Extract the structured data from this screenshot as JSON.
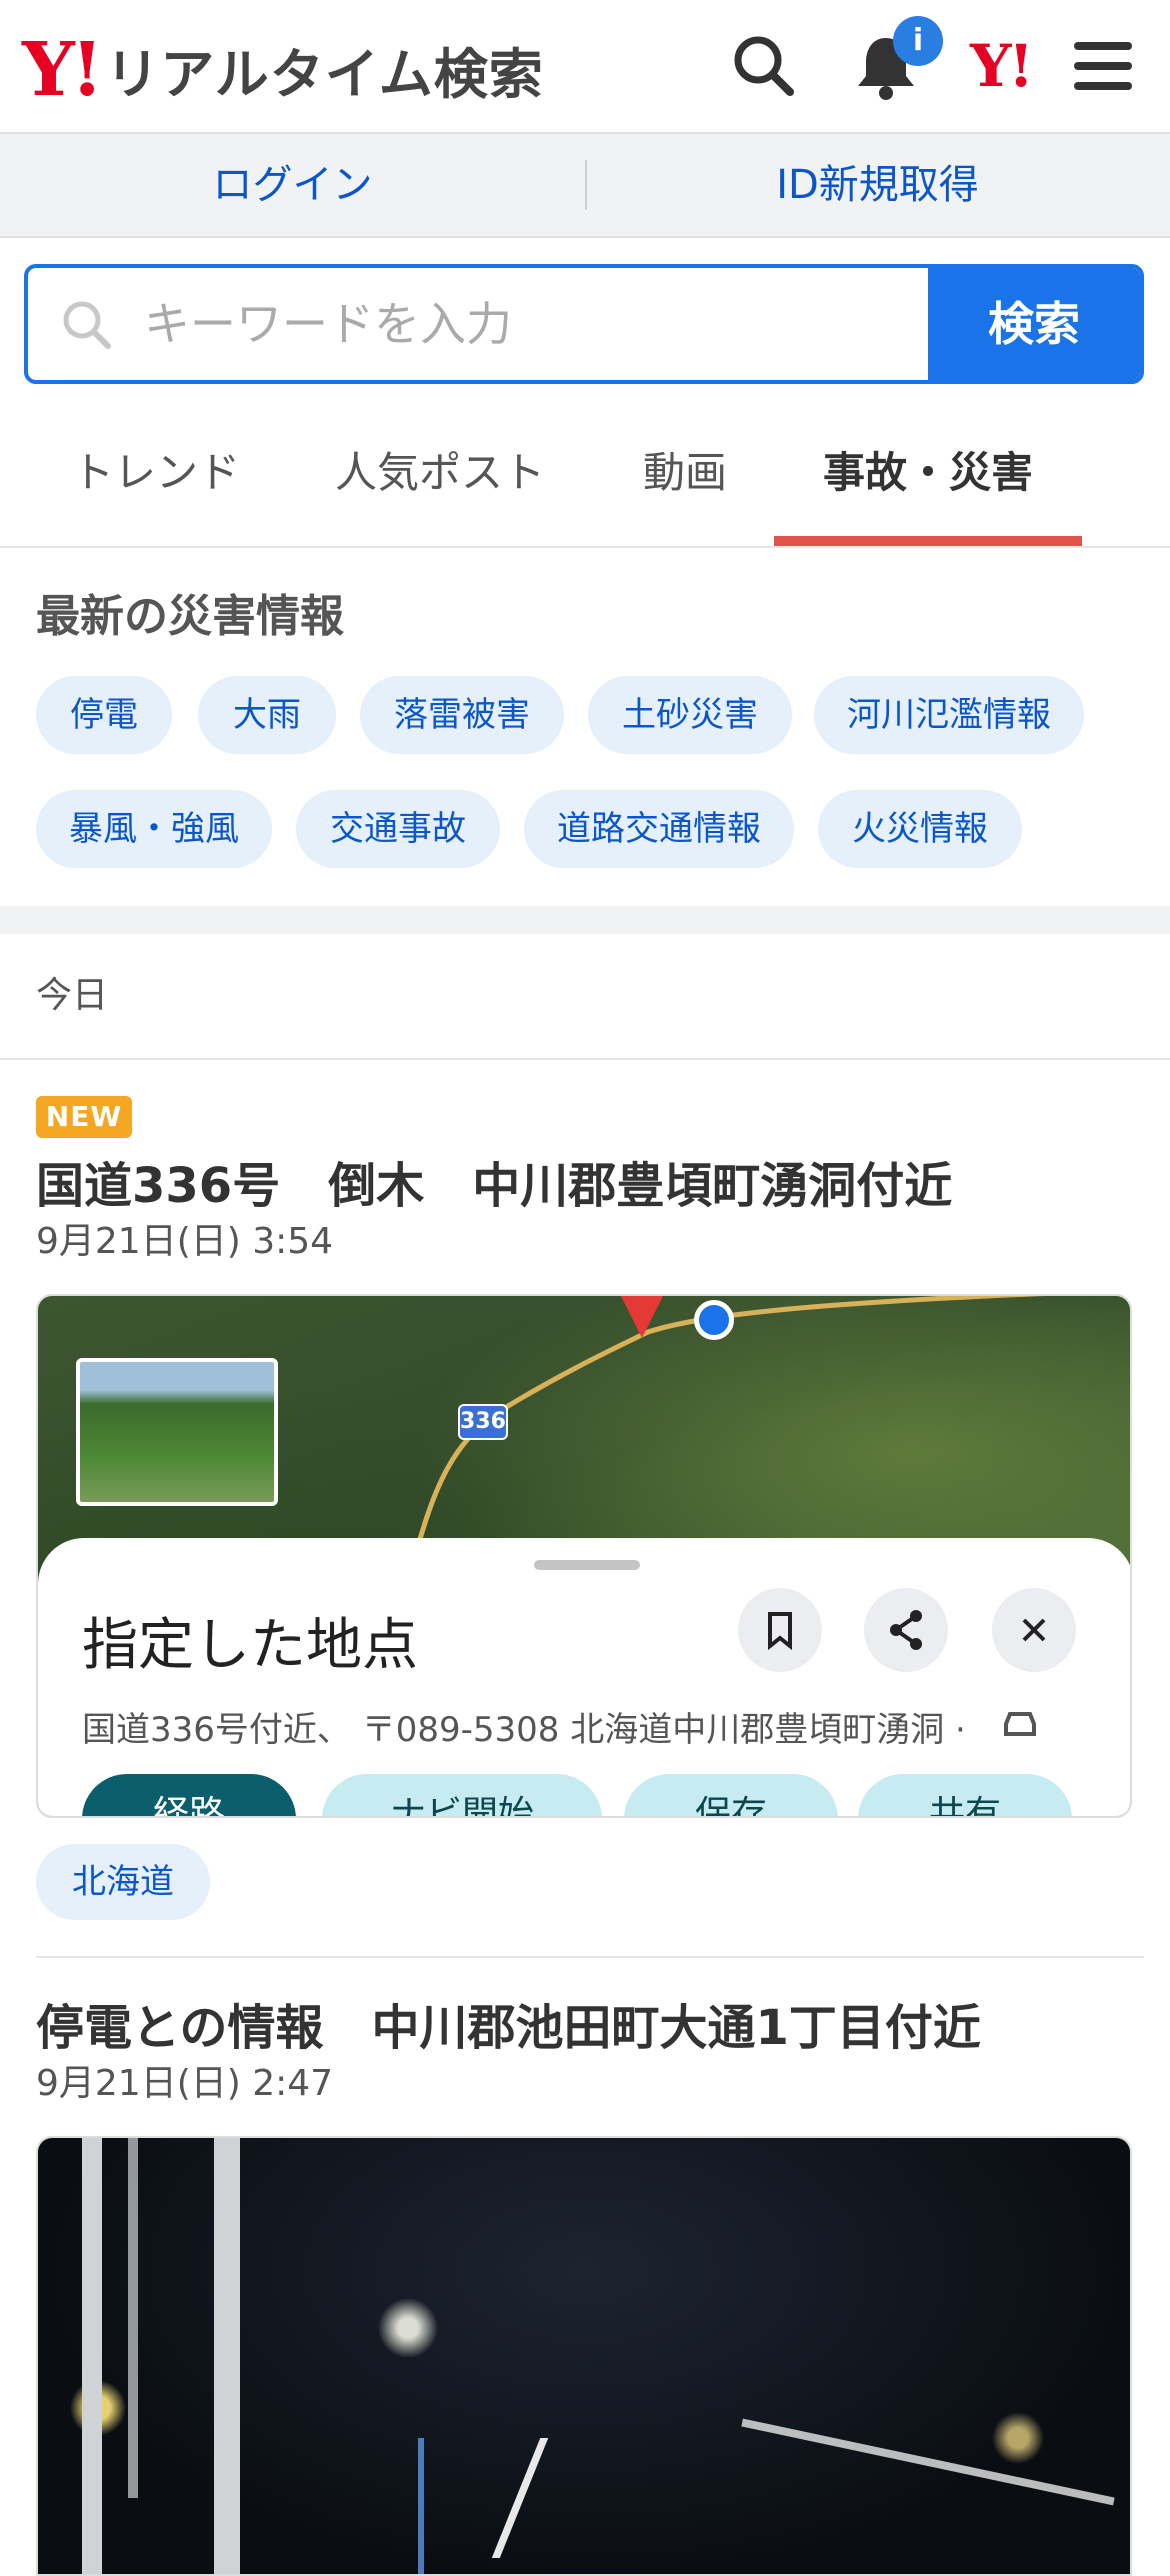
{
  "header": {
    "logo_mark": "Y!",
    "title": "リアルタイム検索",
    "notification_badge": "i",
    "brand_mark": "Y!"
  },
  "auth": {
    "login": "ログイン",
    "signup": "ID新規取得"
  },
  "search": {
    "placeholder": "キーワードを入力",
    "button": "検索"
  },
  "tabs": [
    {
      "label": "トレンド",
      "active": false
    },
    {
      "label": "人気ポスト",
      "active": false
    },
    {
      "label": "動画",
      "active": false
    },
    {
      "label": "事故・災害",
      "active": true
    }
  ],
  "disaster": {
    "title": "最新の災害情報",
    "chips": [
      "停電",
      "大雨",
      "落雷被害",
      "土砂災害",
      "河川氾濫情報",
      "暴風・強風",
      "交通事故",
      "道路交通情報",
      "火災情報"
    ]
  },
  "feed": {
    "day_label": "今日",
    "posts": [
      {
        "badge": "NEW",
        "title": "国道336号　倒木　中川郡豊頃町湧洞付近",
        "date": "9月21日(日) 3:54",
        "tag": "北海道",
        "map": {
          "route_label": "336",
          "place_title": "指定した地点",
          "address": "国道336号付近、 〒089-5308 北海道中川郡豊頃町湧洞 ·",
          "actions": [
            "経路",
            "ナビ開始",
            "保存",
            "共有"
          ]
        }
      },
      {
        "badge": "",
        "title": "停電との情報　中川郡池田町大通1丁目付近",
        "date": "9月21日(日) 2:47"
      }
    ]
  },
  "colors": {
    "brand_red": "#e60023",
    "link_blue": "#0b57c9",
    "search_blue": "#1a73e8",
    "tab_underline": "#e0544a",
    "new_badge": "#f5a623",
    "chip_bg": "#e5f0fb"
  }
}
